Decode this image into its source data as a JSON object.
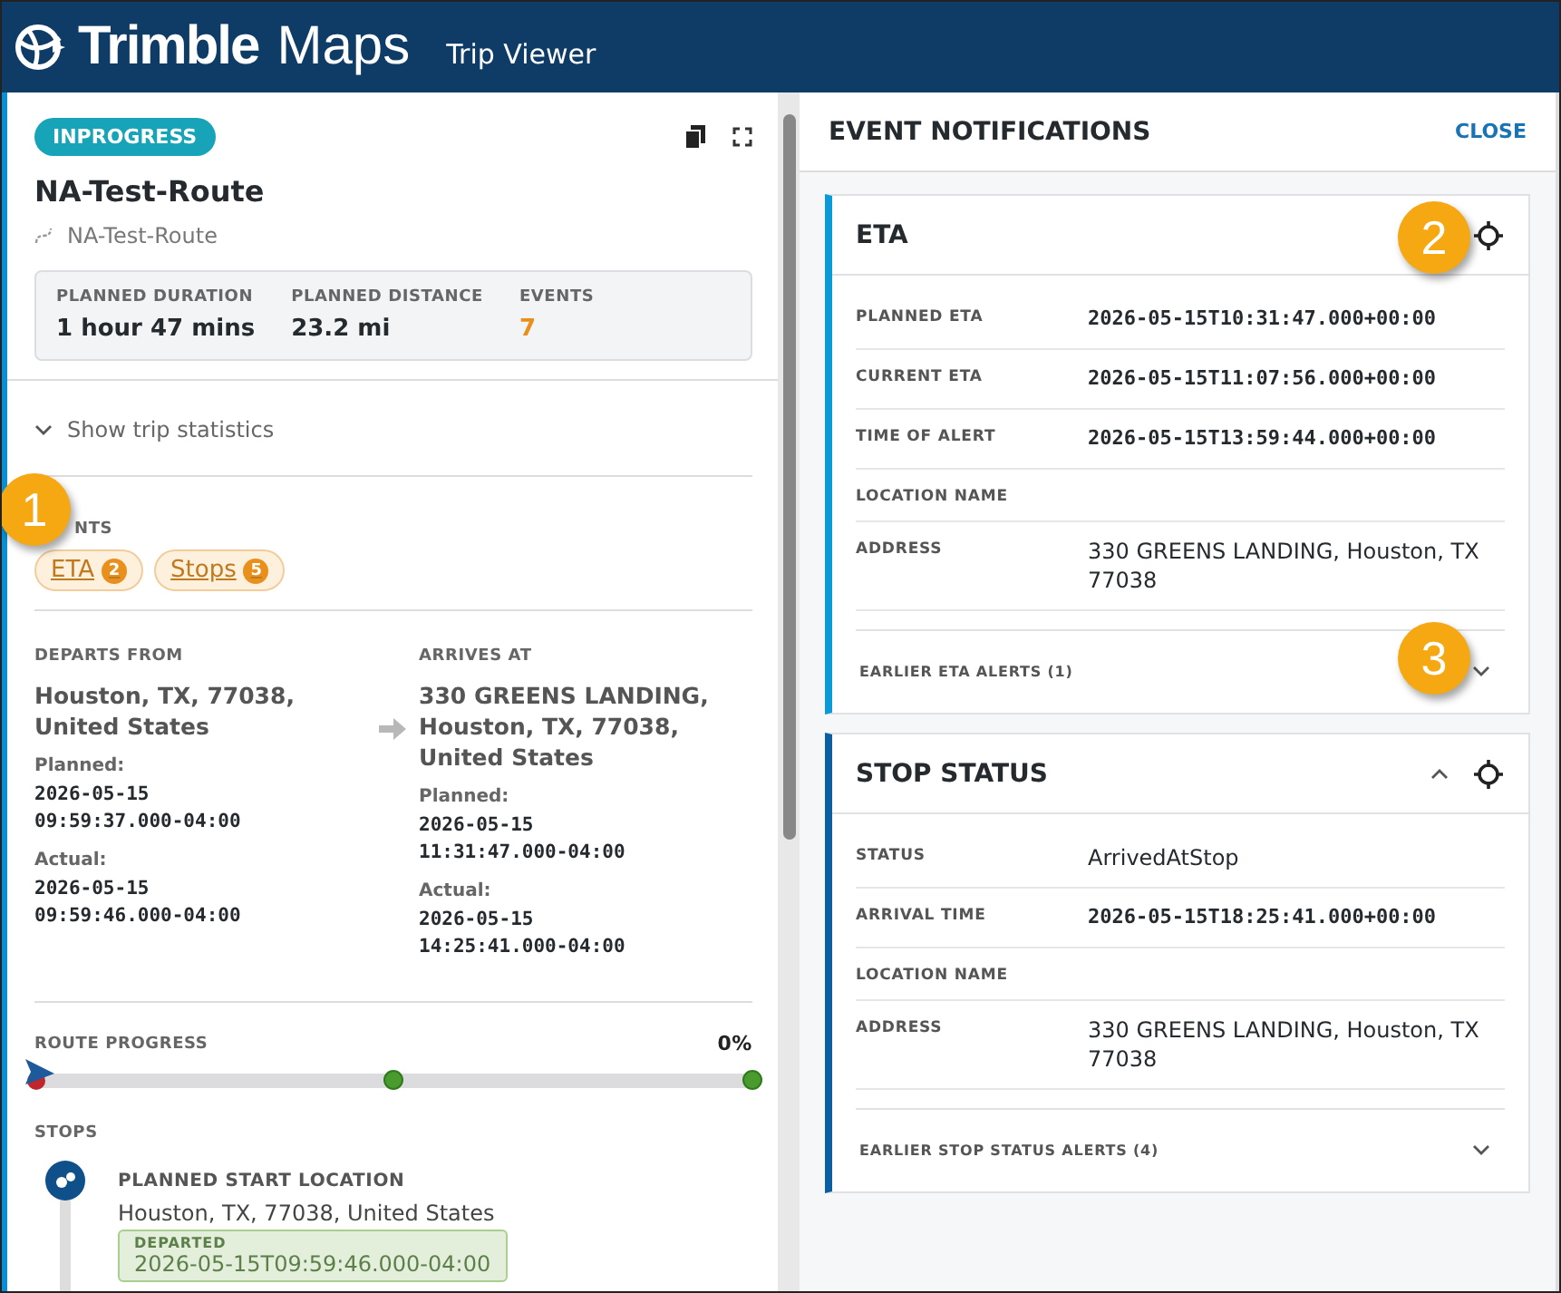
{
  "header": {
    "brand": "Trimble",
    "brand_suffix": "Maps",
    "title": "Trip Viewer"
  },
  "trip": {
    "status": "INPROGRESS",
    "name": "NA-Test-Route",
    "route": "NA-Test-Route",
    "stats": [
      {
        "label": "PLANNED DURATION",
        "value": "1 hour 47 mins",
        "kind": "plain"
      },
      {
        "label": "PLANNED DISTANCE",
        "value": "23.2 mi",
        "kind": "plain"
      },
      {
        "label": "EVENTS",
        "value": "7",
        "kind": "accent"
      }
    ],
    "statistics_toggle": "Show trip statistics",
    "events_label": "NTS",
    "event_chips": [
      {
        "label": "ETA",
        "count": "2"
      },
      {
        "label": "Stops",
        "count": "5"
      }
    ],
    "departs": {
      "heading": "DEPARTS FROM",
      "place": "Houston, TX, 77038, United States",
      "planned_label": "Planned:",
      "planned": [
        "2026-05-15",
        "09:59:37.000-04:00"
      ],
      "actual_label": "Actual:",
      "actual": [
        "2026-05-15",
        "09:59:46.000-04:00"
      ]
    },
    "arrives": {
      "heading": "ARRIVES AT",
      "place": "330 GREENS LANDING, Houston, TX, 77038, United States",
      "planned_label": "Planned:",
      "planned": [
        "2026-05-15",
        "11:31:47.000-04:00"
      ],
      "actual_label": "Actual:",
      "actual": [
        "2026-05-15",
        "14:25:41.000-04:00"
      ]
    },
    "route_progress": {
      "label": "ROUTE PROGRESS",
      "reading": "0%",
      "level": 0
    },
    "stops_label": "STOPS",
    "stops": [
      {
        "title": "PLANNED START LOCATION",
        "address": "Houston, TX, 77038, United States",
        "status": "DEPARTED",
        "time": "2026-05-15T09:59:46.000-04:00"
      }
    ]
  },
  "notifications": {
    "title": "EVENT NOTIFICATIONS",
    "close": "CLOSE",
    "cards": [
      {
        "title": "ETA",
        "color": "#0a9ad8",
        "actions": [
          {
            "kind": "locate"
          }
        ],
        "fields": [
          {
            "label": "PLANNED ETA",
            "value": "2026-05-15T10:31:47.000+00:00",
            "kind": "mono"
          },
          {
            "label": "CURRENT ETA",
            "value": "2026-05-15T11:07:56.000+00:00",
            "kind": "mono"
          },
          {
            "label": "TIME OF ALERT",
            "value": "2026-05-15T13:59:44.000+00:00",
            "kind": "mono"
          },
          {
            "label": "LOCATION NAME"
          },
          {
            "label": "ADDRESS",
            "value": "330 GREENS LANDING, Houston, TX 77038",
            "kind": "text"
          }
        ],
        "earlier": "EARLIER ETA ALERTS",
        "earlier_count": "(1)"
      },
      {
        "title": "STOP STATUS",
        "color": "#0b5fa0",
        "actions": [
          {
            "kind": "collapse"
          },
          {
            "kind": "locate"
          }
        ],
        "fields": [
          {
            "label": "STATUS",
            "value": "ArrivedAtStop",
            "kind": "text"
          },
          {
            "label": "ARRIVAL TIME",
            "value": "2026-05-15T18:25:41.000+00:00",
            "kind": "mono"
          },
          {
            "label": "LOCATION NAME"
          },
          {
            "label": "ADDRESS",
            "value": "330 GREENS LANDING, Houston, TX 77038",
            "kind": "text"
          }
        ],
        "earlier": "EARLIER STOP STATUS ALERTS",
        "earlier_count": "(4)"
      }
    ]
  },
  "callouts": [
    "1",
    "2",
    "3"
  ]
}
